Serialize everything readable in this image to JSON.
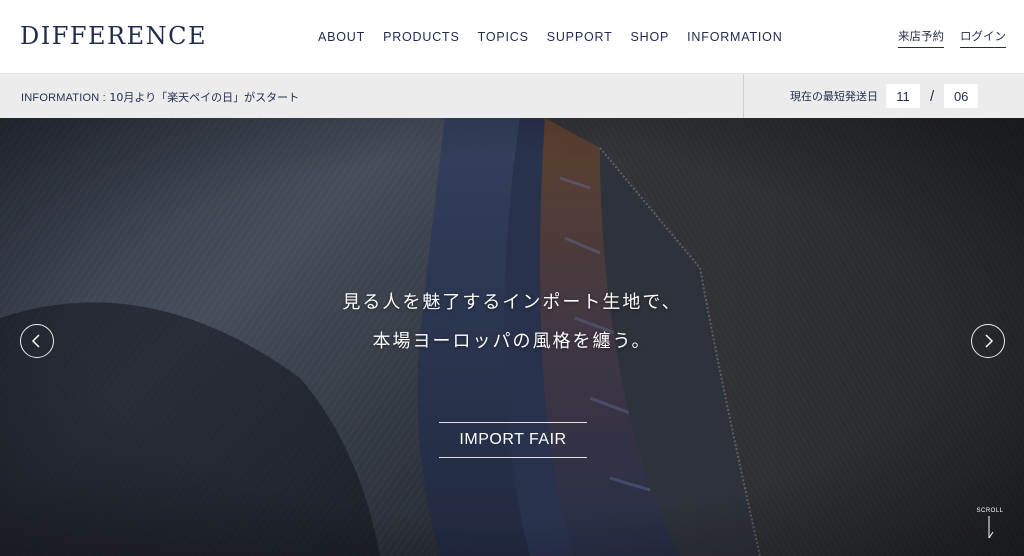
{
  "header": {
    "logo": "DIFFERENCE",
    "nav": [
      {
        "label": "ABOUT"
      },
      {
        "label": "PRODUCTS"
      },
      {
        "label": "TOPICS"
      },
      {
        "label": "SUPPORT"
      },
      {
        "label": "SHOP"
      },
      {
        "label": "INFORMATION"
      }
    ],
    "reservation": "来店予約",
    "login": "ログイン"
  },
  "infobar": {
    "label": "INFORMATION :",
    "message": "10月より「楽天ペイの日」がスタート",
    "ship_label": "現在の最短発送日",
    "month": "11",
    "separator": "/",
    "day": "06"
  },
  "hero": {
    "line1": "見る人を魅了するインポート生地で、",
    "line2": "本場ヨーロッパの風格を纏う。",
    "cta": "IMPORT FAIR",
    "scroll_label": "SCROLL",
    "icons": {
      "prev": "chevron-left-icon",
      "next": "chevron-right-icon",
      "scroll": "arrow-down-icon"
    }
  },
  "colors": {
    "brand": "#1f2c4d",
    "infobar_bg": "#ececec"
  }
}
